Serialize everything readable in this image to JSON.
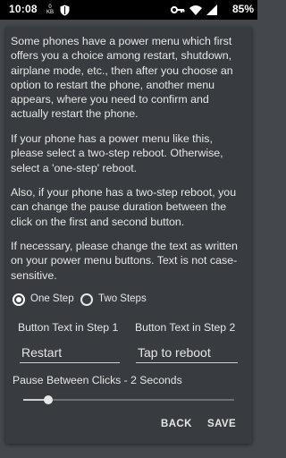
{
  "status_bar": {
    "time": "10:08",
    "data_rate_top": "0",
    "data_rate_unit": "KB",
    "battery_percent": "85%",
    "icons": [
      "kbs-indicator",
      "shield-icon",
      "vpn-key-icon",
      "wifi-icon",
      "signal-icon",
      "battery-icon"
    ]
  },
  "dialog": {
    "paragraphs": [
      "Some phones have a power menu which first offers you a choice among restart, shutdown, airplane mode, etc., then after you choose an option to restart the phone, another menu appears, where you need to confirm and actually restart the phone.",
      "If your phone has a power menu like this, please select a two-step reboot. Otherwise, select a 'one-step' reboot.",
      "Also, if your phone has a two-step reboot, you can change the pause duration between the click on the first and second button.",
      "If necessary, please change the text as written on your power menu buttons. Text is not case-sensitive."
    ],
    "options": {
      "one_step": "One Step",
      "two_steps": "Two Steps",
      "selected": "one_step"
    },
    "fields": {
      "step1_label": "Button Text in Step 1",
      "step2_label": "Button Text in Step 2",
      "step1_value": "Restart",
      "step2_value": "Tap to reboot"
    },
    "pause": {
      "label": "Pause Between Clicks - 2 Seconds",
      "slider_value": 2,
      "slider_max": 60
    },
    "actions": {
      "back": "BACK",
      "save": "SAVE"
    }
  },
  "colors": {
    "background": "#44474c",
    "dialog": "#383b40",
    "text": "#e6e6e6"
  }
}
